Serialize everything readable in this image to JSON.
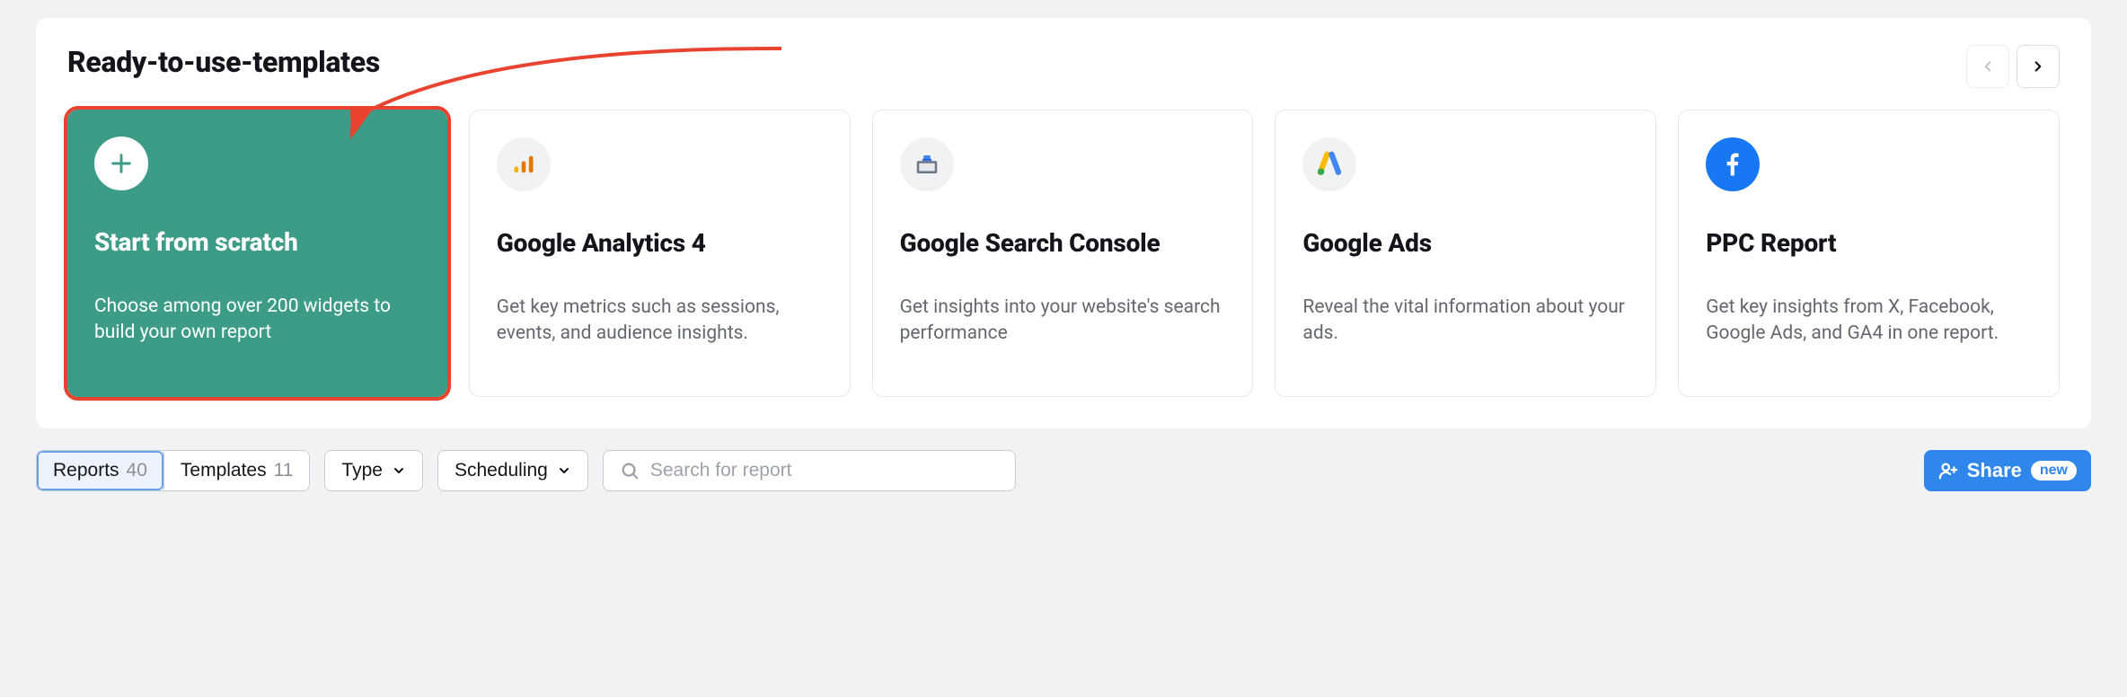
{
  "panel": {
    "title": "Ready-to-use-templates"
  },
  "cards": [
    {
      "title": "Start from scratch",
      "desc": "Choose among over 200 widgets to build your own report"
    },
    {
      "title": "Google Analytics 4",
      "desc": "Get key metrics such as sessions, events, and audience insights."
    },
    {
      "title": "Google Search Console",
      "desc": "Get insights into your website's search performance"
    },
    {
      "title": "Google Ads",
      "desc": "Reveal the vital information about your ads."
    },
    {
      "title": "PPC Report",
      "desc": "Get key insights from X, Facebook, Google Ads, and GA4 in one report."
    }
  ],
  "tabs": {
    "reports_label": "Reports",
    "reports_count": "40",
    "templates_label": "Templates",
    "templates_count": "11"
  },
  "filters": {
    "type_label": "Type",
    "scheduling_label": "Scheduling"
  },
  "search": {
    "placeholder": "Search for report"
  },
  "share": {
    "label": "Share",
    "badge": "new"
  }
}
